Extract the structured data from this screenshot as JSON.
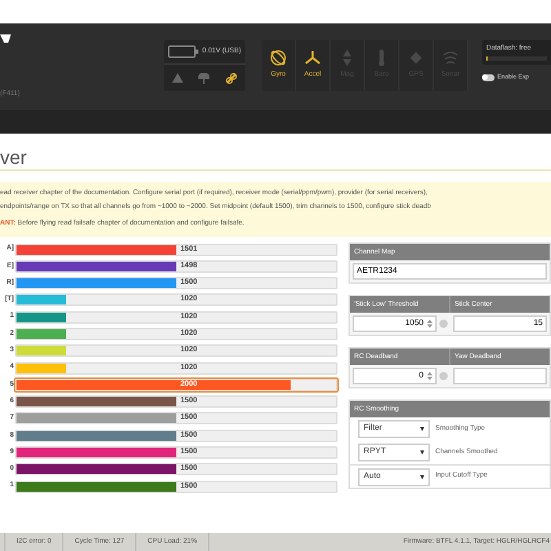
{
  "header": {
    "board_label": "(F411)",
    "battery": {
      "reading": "0.01V (USB)"
    },
    "status_icons": [
      {
        "kind": "warning",
        "active": false
      },
      {
        "kind": "failsafe",
        "active": false
      },
      {
        "kind": "link",
        "active": true
      }
    ],
    "sensors": [
      {
        "label": "Gyro",
        "active": true
      },
      {
        "label": "Accel",
        "active": true
      },
      {
        "label": "Mag",
        "active": false
      },
      {
        "label": "Baro",
        "active": false
      },
      {
        "label": "GPS",
        "active": false
      },
      {
        "label": "Sonar",
        "active": false
      }
    ],
    "dataflash": {
      "label": "Dataflash: free",
      "level": 0.03
    },
    "expert_mode": {
      "label": "Enable Exp",
      "on": false
    }
  },
  "page_title": "ver",
  "notes": [
    "ead receiver chapter of the documentation. Configure serial port (if required), receiver mode (serial/ppm/pwm), provider (for serial receivers),",
    "endpoints/range on TX so that all channels go from ~1000 to ~2000. Set midpoint (default 1500), trim channels to 1500, configure stick deadb"
  ],
  "warning": "**ANT:** Before flying read failsafe chapter of documentation and configure failsafe.",
  "channels": [
    {
      "name": "A]",
      "value": "1501",
      "level": 0.5,
      "color": "#f44336",
      "selected": false
    },
    {
      "name": "E]",
      "value": "1498",
      "level": 0.5,
      "color": "#673ab7",
      "selected": false
    },
    {
      "name": "R]",
      "value": "1500",
      "level": 0.5,
      "color": "#2196f3",
      "selected": false
    },
    {
      "name": "[T]",
      "value": "1020",
      "level": 0.157,
      "color": "#26bcd7",
      "selected": false
    },
    {
      "name": "1",
      "value": "1020",
      "level": 0.157,
      "color": "#159688",
      "selected": false
    },
    {
      "name": "2",
      "value": "1020",
      "level": 0.157,
      "color": "#4caf50",
      "selected": false
    },
    {
      "name": "3",
      "value": "1020",
      "level": 0.157,
      "color": "#cddc39",
      "selected": false
    },
    {
      "name": "4",
      "value": "1020",
      "level": 0.157,
      "color": "#ffc107",
      "selected": false
    },
    {
      "name": "5",
      "value": "2000",
      "level": 0.857,
      "color": "#ff5722",
      "selected": true
    },
    {
      "name": "6",
      "value": "1500",
      "level": 0.5,
      "color": "#795548",
      "selected": false
    },
    {
      "name": "7",
      "value": "1500",
      "level": 0.5,
      "color": "#9e9e9e",
      "selected": false
    },
    {
      "name": "8",
      "value": "1500",
      "level": 0.5,
      "color": "#607d8b",
      "selected": false
    },
    {
      "name": "9",
      "value": "1500",
      "level": 0.5,
      "color": "#e0257b",
      "selected": false
    },
    {
      "name": "0",
      "value": "1500",
      "level": 0.5,
      "color": "#7b1466",
      "selected": false
    },
    {
      "name": "1",
      "value": "1500",
      "level": 0.5,
      "color": "#3c7a1a",
      "selected": false
    }
  ],
  "settings": [
    {
      "kind": "text",
      "headers": [
        "Channel Map"
      ],
      "values": [
        "AETR1234"
      ]
    },
    {
      "kind": "number",
      "headers": [
        "'Stick Low' Threshold",
        "Stick Center"
      ],
      "values": [
        "1050",
        "15"
      ]
    },
    {
      "kind": "number",
      "headers": [
        "RC Deadband",
        "Yaw Deadband"
      ],
      "values": [
        "0"
      ]
    }
  ],
  "smoothing": {
    "title": "RC Smoothing",
    "rows": [
      {
        "value": "Filter",
        "label": "Smoothing Type"
      },
      {
        "value": "RPYT",
        "label": "Channels Smoothed"
      },
      {
        "value": "Auto",
        "label": "Input Cutoff Type"
      }
    ]
  },
  "status_bar": [
    "I2C error: 0",
    "Cycle Time: 127",
    "CPU Load: 21%"
  ],
  "firmware": "Firmware: BTFL 4.1.1, Target: HGLR/HGLRCF4"
}
